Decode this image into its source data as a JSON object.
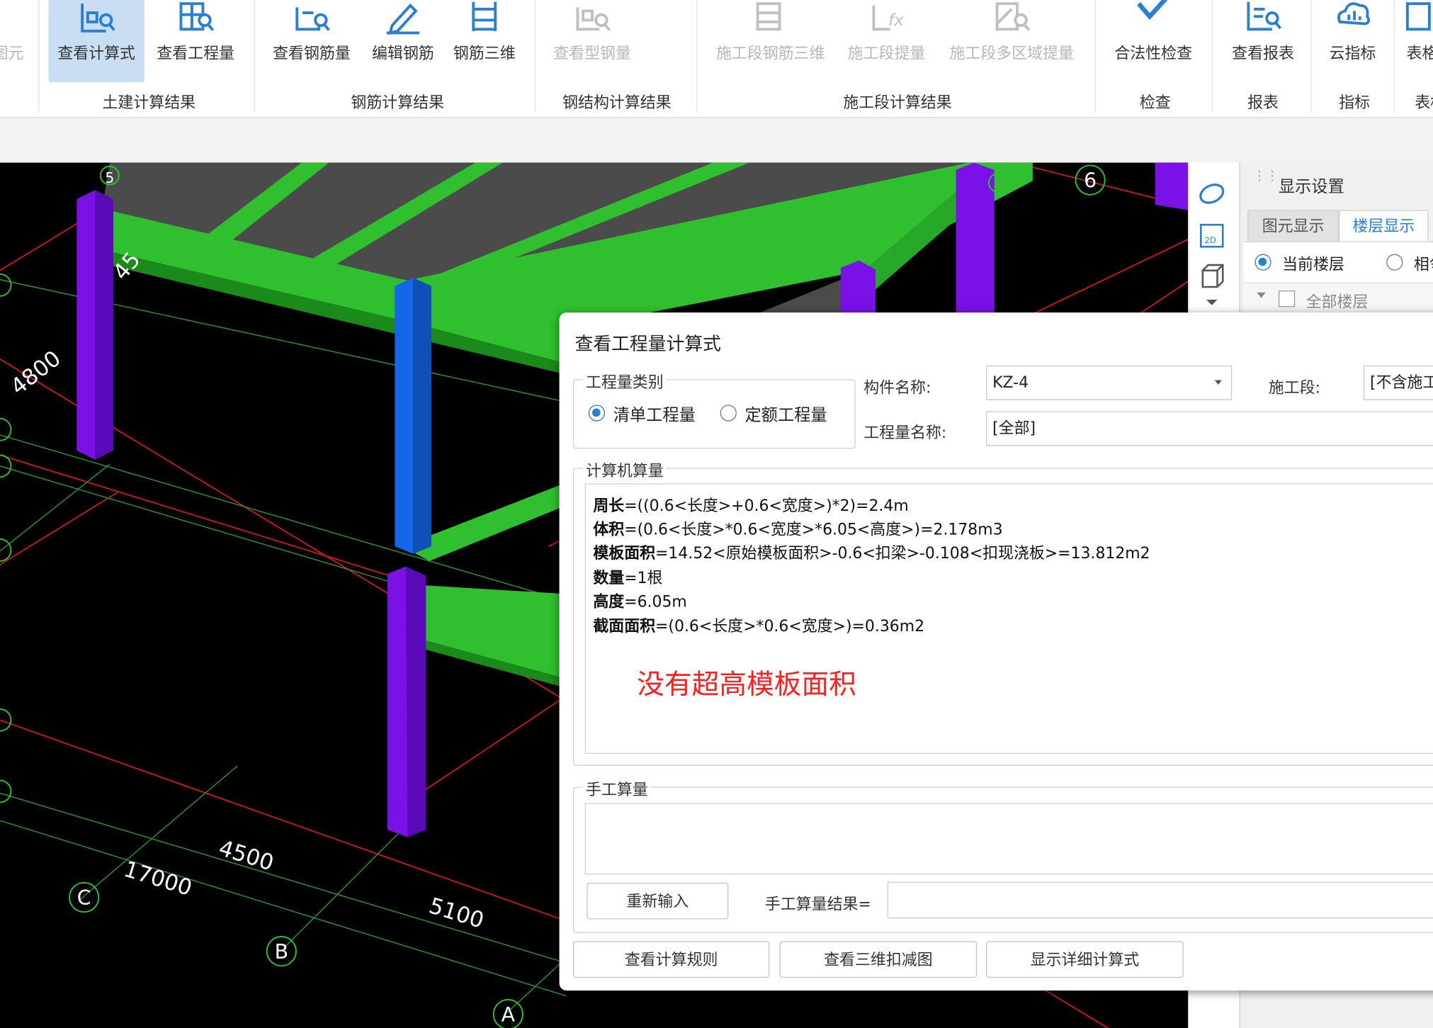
{
  "ribbon": {
    "cut_label": "图元",
    "buttons": [
      {
        "label": "查看计算式",
        "icon": "formula-view-icon",
        "active": true
      },
      {
        "label": "查看工程量",
        "icon": "quantity-view-icon"
      },
      {
        "label": "查看钢筋量",
        "icon": "rebar-quantity-icon"
      },
      {
        "label": "编辑钢筋",
        "icon": "edit-rebar-icon"
      },
      {
        "label": "钢筋三维",
        "icon": "rebar-3d-icon"
      },
      {
        "label": "查看型钢量",
        "icon": "steel-quantity-icon",
        "disabled": true
      },
      {
        "label": "施工段钢筋三维",
        "icon": "segment-rebar-3d-icon",
        "disabled": true
      },
      {
        "label": "施工段提量",
        "icon": "segment-extract-icon",
        "disabled": true
      },
      {
        "label": "施工段多区域提量",
        "icon": "segment-multi-extract-icon",
        "disabled": true
      },
      {
        "label": "合法性检查",
        "icon": "check-icon"
      },
      {
        "label": "查看报表",
        "icon": "report-icon"
      },
      {
        "label": "云指标",
        "icon": "cloud-index-icon"
      },
      {
        "label": "表格",
        "icon": "table-icon"
      }
    ],
    "groups": [
      "土建计算结果",
      "钢筋计算结果",
      "钢结构计算结果",
      "施工段计算结果",
      "检查",
      "报表",
      "指标",
      "表格"
    ]
  },
  "viewport": {
    "axis_labels": [
      "5",
      "6",
      "C",
      "B",
      "A"
    ],
    "dimensions": [
      "4800",
      "4500",
      "17000",
      "5100",
      "45"
    ]
  },
  "display_panel": {
    "title": "显示设置",
    "tabs": [
      "图元显示",
      "楼层显示"
    ],
    "options": [
      "当前楼层",
      "相邻楼层"
    ],
    "all_floors": "全部楼层"
  },
  "dialog": {
    "title": "查看工程量计算式",
    "quantity_type_label": "工程量类别",
    "radio_bill": "清单工程量",
    "radio_quota": "定额工程量",
    "component_label": "构件名称:",
    "component_value": "KZ-4",
    "segment_label": "施工段:",
    "segment_value": "[不含施工段]",
    "quantity_name_label": "工程量名称:",
    "quantity_name_value": "[全部]",
    "computer_section": "计算机算量",
    "calc": [
      {
        "name": "周长",
        "expr": "=((0.6<长度>+0.6<宽度>)*2)=2.4m"
      },
      {
        "name": "体积",
        "expr": "=(0.6<长度>*0.6<宽度>*6.05<高度>)=2.178m3"
      },
      {
        "name": "模板面积",
        "expr": "=14.52<原始模板面积>-0.6<扣梁>-0.108<扣现浇板>=13.812m2"
      },
      {
        "name": "数量",
        "expr": "=1根"
      },
      {
        "name": "高度",
        "expr": "=6.05m"
      },
      {
        "name": "截面面积",
        "expr": "=(0.6<长度>*0.6<宽度>)=0.36m2"
      }
    ],
    "annotation": "没有超高模板面积",
    "manual_section": "手工算量",
    "reenter_button": "重新输入",
    "manual_result_label": "手工算量结果=",
    "buttons": [
      "查看计算规则",
      "查看三维扣减图",
      "显示详细计算式"
    ]
  }
}
